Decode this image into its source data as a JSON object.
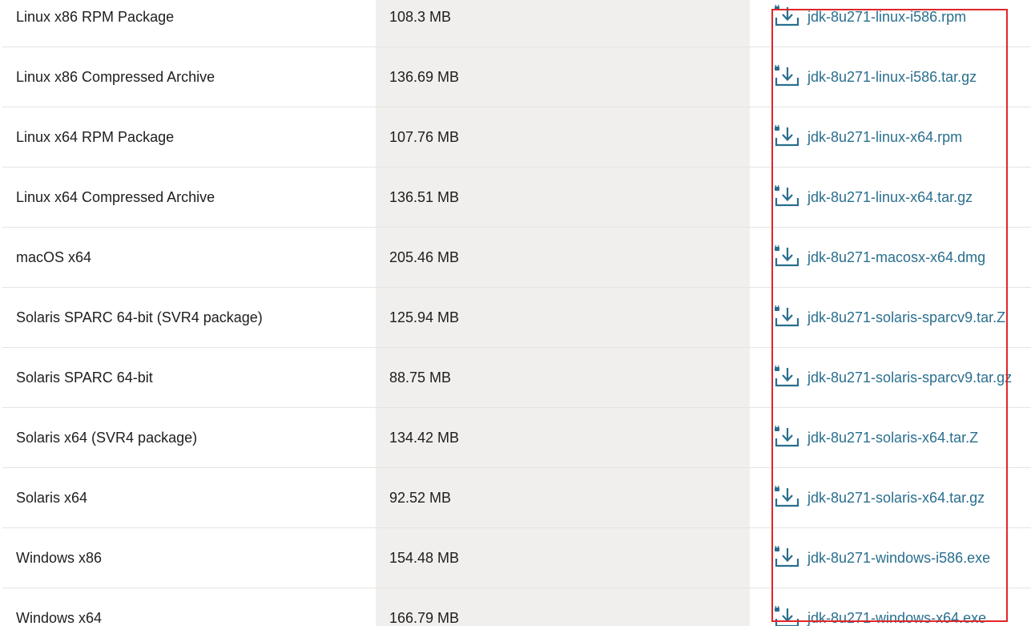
{
  "downloads": {
    "rows": [
      {
        "product": "Linux x86 RPM Package",
        "size": "108.3 MB",
        "file": "jdk-8u271-linux-i586.rpm"
      },
      {
        "product": "Linux x86 Compressed Archive",
        "size": "136.69 MB",
        "file": "jdk-8u271-linux-i586.tar.gz"
      },
      {
        "product": "Linux x64 RPM Package",
        "size": "107.76 MB",
        "file": "jdk-8u271-linux-x64.rpm"
      },
      {
        "product": "Linux x64 Compressed Archive",
        "size": "136.51 MB",
        "file": "jdk-8u271-linux-x64.tar.gz"
      },
      {
        "product": "macOS x64",
        "size": "205.46 MB",
        "file": "jdk-8u271-macosx-x64.dmg"
      },
      {
        "product": "Solaris SPARC 64-bit (SVR4 package)",
        "size": "125.94 MB",
        "file": "jdk-8u271-solaris-sparcv9.tar.Z"
      },
      {
        "product": "Solaris SPARC 64-bit",
        "size": "88.75 MB",
        "file": "jdk-8u271-solaris-sparcv9.tar.gz"
      },
      {
        "product": "Solaris x64 (SVR4 package)",
        "size": "134.42 MB",
        "file": "jdk-8u271-solaris-x64.tar.Z"
      },
      {
        "product": "Solaris x64",
        "size": "92.52 MB",
        "file": "jdk-8u271-solaris-x64.tar.gz"
      },
      {
        "product": "Windows x86",
        "size": "154.48 MB",
        "file": "jdk-8u271-windows-i586.exe"
      },
      {
        "product": "Windows x64",
        "size": "166.79 MB",
        "file": "jdk-8u271-windows-x64.exe"
      }
    ],
    "icon": "lock-download-icon"
  },
  "colors": {
    "link": "#2a6f8e",
    "size_column_bg": "#f1efed",
    "highlight": "#e0262a"
  }
}
